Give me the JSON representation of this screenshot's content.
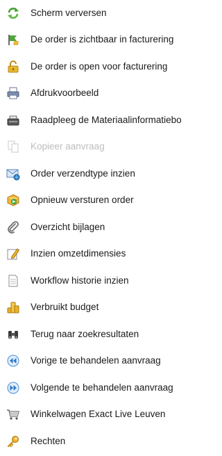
{
  "menu": {
    "items": [
      {
        "label": "Scherm verversen",
        "icon": "refresh-icon",
        "enabled": true
      },
      {
        "label": "De order is zichtbaar in facturering",
        "icon": "flag-icon",
        "enabled": true
      },
      {
        "label": "De order is open voor facturering",
        "icon": "lock-open-icon",
        "enabled": true
      },
      {
        "label": "Afdrukvoorbeeld",
        "icon": "printer-icon",
        "enabled": true
      },
      {
        "label": "Raadpleeg de Materiaalinformatiebo",
        "icon": "fax-icon",
        "enabled": true
      },
      {
        "label": "Kopieer aanvraag",
        "icon": "copy-icon",
        "enabled": false
      },
      {
        "label": "Order verzendtype inzien",
        "icon": "mail-globe-icon",
        "enabled": true
      },
      {
        "label": "Opnieuw versturen order",
        "icon": "package-resend-icon",
        "enabled": true
      },
      {
        "label": "Overzicht bijlagen",
        "icon": "paperclip-icon",
        "enabled": true
      },
      {
        "label": "Inzien omzetdimensies",
        "icon": "edit-icon",
        "enabled": true
      },
      {
        "label": "Workflow historie inzien",
        "icon": "document-icon",
        "enabled": true
      },
      {
        "label": "Verbruikt budget",
        "icon": "coins-icon",
        "enabled": true
      },
      {
        "label": "Terug naar zoekresultaten",
        "icon": "binoculars-icon",
        "enabled": true
      },
      {
        "label": "Vorige te behandelen aanvraag",
        "icon": "rewind-icon",
        "enabled": true
      },
      {
        "label": "Volgende te behandelen aanvraag",
        "icon": "fast-forward-icon",
        "enabled": true
      },
      {
        "label": "Winkelwagen Exact Live Leuven",
        "icon": "cart-icon",
        "enabled": true
      },
      {
        "label": "Rechten",
        "icon": "key-icon",
        "enabled": true
      }
    ]
  },
  "colors": {
    "text": "#1a1a1a",
    "disabled_text": "#bdbdbd"
  }
}
